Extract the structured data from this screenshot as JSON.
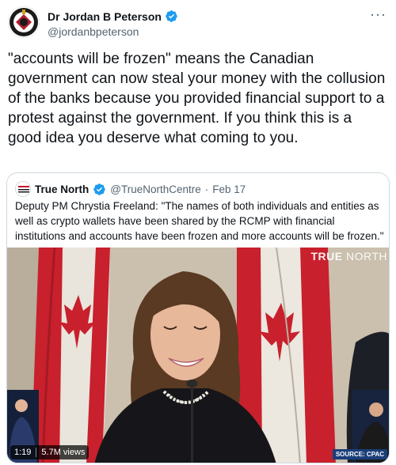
{
  "tweet": {
    "display_name": "Dr Jordan B Peterson",
    "handle": "@jordanbpeterson",
    "more_icon": "more-horizontal-icon",
    "text": "\"accounts will be frozen\" means the Canadian government can now steal your money with the collusion of the banks because you provided financial support to a protest against the government. If you think this is a good idea you deserve what coming to you."
  },
  "quote": {
    "display_name": "True North",
    "handle": "@TrueNorthCentre",
    "separator": "·",
    "date": "Feb 17",
    "text": "Deputy PM Chrystia Freeland: \"The names of both individuals and entities as well as crypto wallets have been shared by the RCMP with financial institutions and accounts have been frozen and more accounts will be frozen.\"",
    "avatar_label": "TRUE NORTH"
  },
  "video": {
    "watermark_bold": "TRUE",
    "watermark_thin": " NORTH",
    "duration": "1:19",
    "views": "5.7M views",
    "source_label": "SOURCE: CPAC"
  },
  "colors": {
    "text": "#0f1419",
    "secondary": "#536471",
    "verified": "#1d9bf0",
    "border": "#cfd9de",
    "flag_red": "#d22630"
  }
}
